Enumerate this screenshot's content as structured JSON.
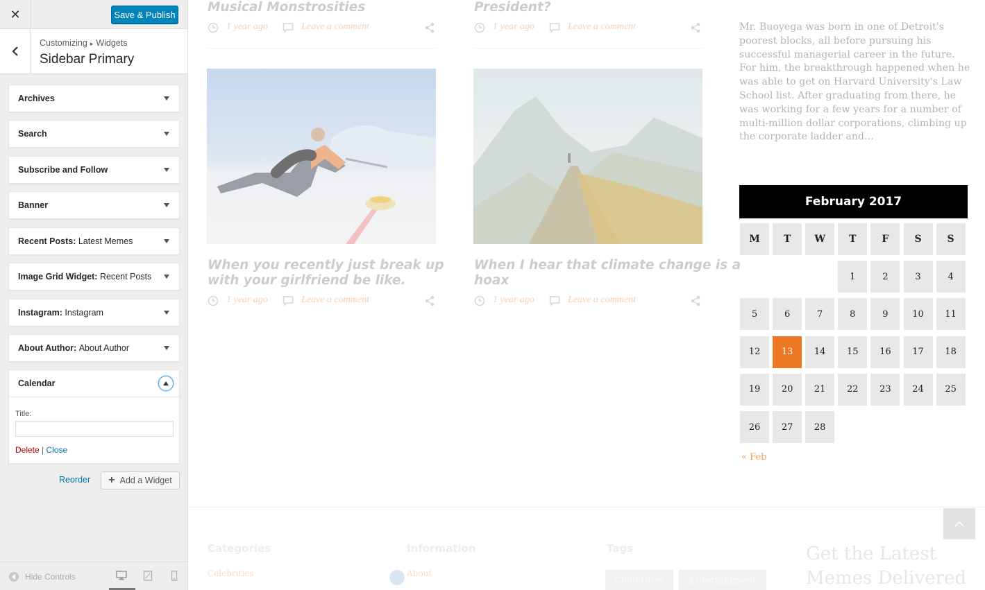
{
  "customizer": {
    "save_label": "Save & Publish",
    "close_glyph": "✕",
    "breadcrumb": {
      "parent": "Customizing",
      "separator": "▸",
      "child": "Widgets"
    },
    "section_title": "Sidebar Primary",
    "widgets": [
      {
        "name": "Archives",
        "subtitle": ""
      },
      {
        "name": "Search",
        "subtitle": ""
      },
      {
        "name": "Subscribe and Follow",
        "subtitle": ""
      },
      {
        "name": "Banner",
        "subtitle": ""
      },
      {
        "name": "Recent Posts:",
        "subtitle": "Latest Memes"
      },
      {
        "name": "Image Grid Widget:",
        "subtitle": "Recent Posts"
      },
      {
        "name": "Instagram:",
        "subtitle": "Instagram"
      },
      {
        "name": "About Author:",
        "subtitle": "About Author"
      }
    ],
    "expanded_widget": {
      "name": "Calendar",
      "field_label": "Title:",
      "field_value": "",
      "delete_label": "Delete",
      "separator": "|",
      "close_label": "Close"
    },
    "reorder_label": "Reorder",
    "add_widget_label": "Add a Widget",
    "hide_controls_label": "Hide Controls"
  },
  "preview": {
    "posts_top": [
      {
        "title": "Musical Monstrosities",
        "time": "1 year ago",
        "comment": "Leave a comment"
      },
      {
        "title": "President?",
        "time": "1 year ago",
        "comment": "Leave a comment"
      }
    ],
    "posts": [
      {
        "title_line1": "When you recently just break up",
        "title_line2": "with your girlfriend be like.",
        "time": "1 year ago",
        "comment": "Leave a comment",
        "image": "curling-player-photo"
      },
      {
        "title_line1": "When I hear that climate change is a",
        "title_line2": "hoax",
        "time": "1 year ago",
        "comment": "Leave a comment",
        "image": "mountain-ridge-photo"
      }
    ],
    "about_text": "Mr. Buoyega was born in one of Detroit's poorest blocks, all before pursuing his successful managerial career in the future. For him, the breakthrough happened when he was able to get on Harvard University's Law School list. After graduating from there, he was working for a few years for a number of multi-million dollar corporations, climbing up the corporate ladder and...",
    "calendar": {
      "caption": "February 2017",
      "weekdays": [
        "M",
        "T",
        "W",
        "T",
        "F",
        "S",
        "S"
      ],
      "first_weekday_index": 3,
      "days_in_month": 28,
      "today": 13,
      "prev_label": "« Feb",
      "today_color": "#ed7722"
    },
    "footer": {
      "categories_heading": "Categories",
      "categories_link": "Celebrities",
      "information_heading": "Information",
      "information_link": "About",
      "tags_heading": "Tags",
      "tags": [
        "Celebrities",
        "Entertainment"
      ],
      "newsletter_heading": "Get the Latest Memes Delivered"
    }
  }
}
